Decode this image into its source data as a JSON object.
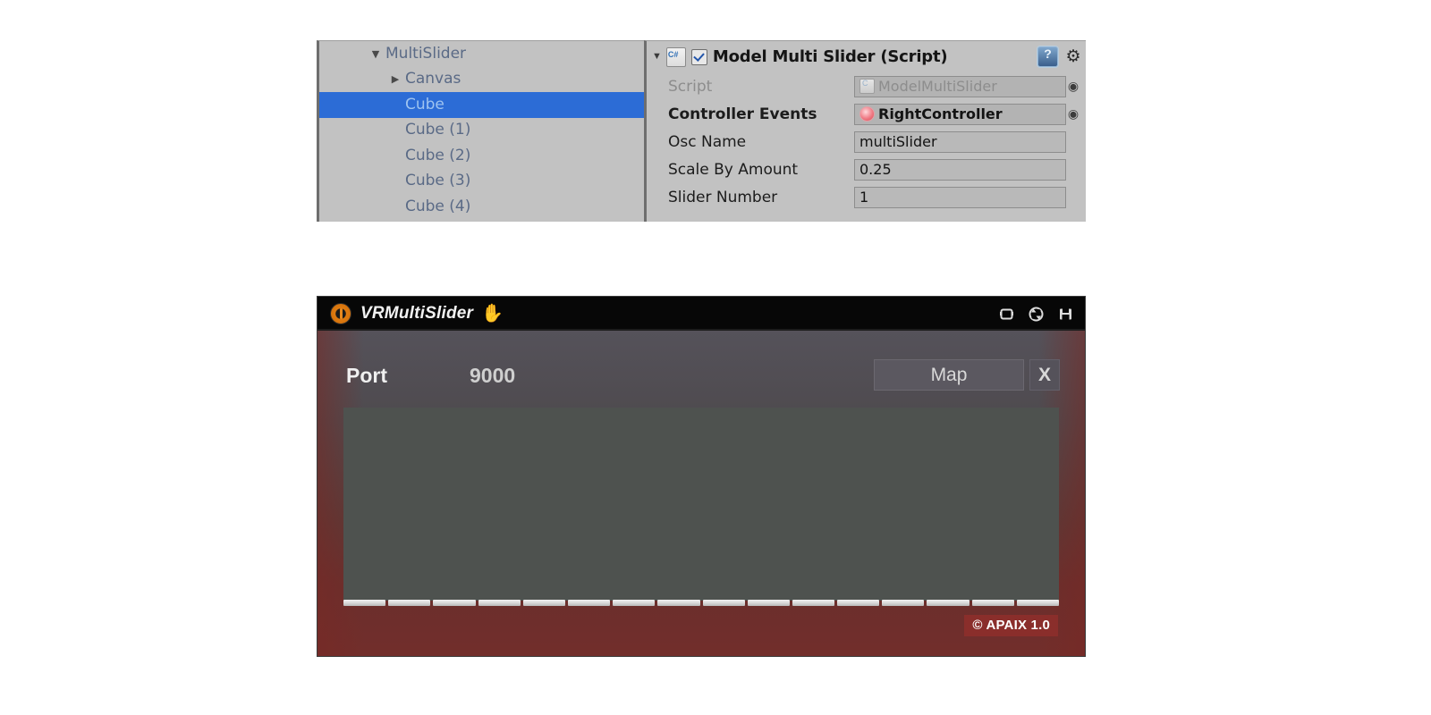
{
  "hierarchy": {
    "rows": [
      {
        "label": "MultiSlider",
        "arrow": "▼",
        "indent": 56,
        "selected": false
      },
      {
        "label": "Canvas",
        "arrow": "▶",
        "indent": 78,
        "selected": false
      },
      {
        "label": "Cube",
        "arrow": "",
        "indent": 96,
        "selected": true
      },
      {
        "label": "Cube (1)",
        "arrow": "",
        "indent": 96,
        "selected": false
      },
      {
        "label": "Cube (2)",
        "arrow": "",
        "indent": 96,
        "selected": false
      },
      {
        "label": "Cube (3)",
        "arrow": "",
        "indent": 96,
        "selected": false
      },
      {
        "label": "Cube (4)",
        "arrow": "",
        "indent": 96,
        "selected": false
      }
    ]
  },
  "inspector": {
    "title": "Model Multi Slider (Script)",
    "enabled_checkbox": true,
    "script_icon": "csharp-script-icon",
    "help_icon": "help-icon",
    "settings_icon": "gear-icon",
    "rows": [
      {
        "label": "Script",
        "value": "ModelMultiSlider",
        "field_type": "object",
        "icon": "script-asset-icon",
        "dim": true,
        "bold": false,
        "picker": "◉"
      },
      {
        "label": "Controller Events",
        "value": "RightController",
        "field_type": "object",
        "icon": "prefab-icon",
        "dim": false,
        "bold": true,
        "picker": "◉"
      },
      {
        "label": "Osc Name",
        "value": "multiSlider",
        "field_type": "text",
        "icon": "",
        "dim": false,
        "bold": false,
        "picker": ""
      },
      {
        "label": "Scale By Amount",
        "value": "0.25",
        "field_type": "text",
        "icon": "",
        "dim": false,
        "bold": false,
        "picker": ""
      },
      {
        "label": "Slider Number",
        "value": "1",
        "field_type": "text",
        "icon": "",
        "dim": false,
        "bold": false,
        "picker": ""
      }
    ]
  },
  "vr_window": {
    "titlebar": {
      "title": "VRMultiSlider",
      "app_icon": "orange-info-icon",
      "hand_icon": "✋",
      "icons": [
        "window-icon",
        "refresh-icon",
        "save-icon"
      ]
    },
    "port_label": "Port",
    "port_value": "9000",
    "map_button": "Map",
    "close_button": "X",
    "slider_segments": 16,
    "copyright": "© APAIX 1.0",
    "colors": {
      "titlebar_bg": "#070707",
      "body_top": "#55525a",
      "body_bottom": "#722e2b",
      "canvas_bg": "#4e524f",
      "accent_red": "#8a2e2b",
      "slider_fill": "#e6e6e6"
    }
  }
}
